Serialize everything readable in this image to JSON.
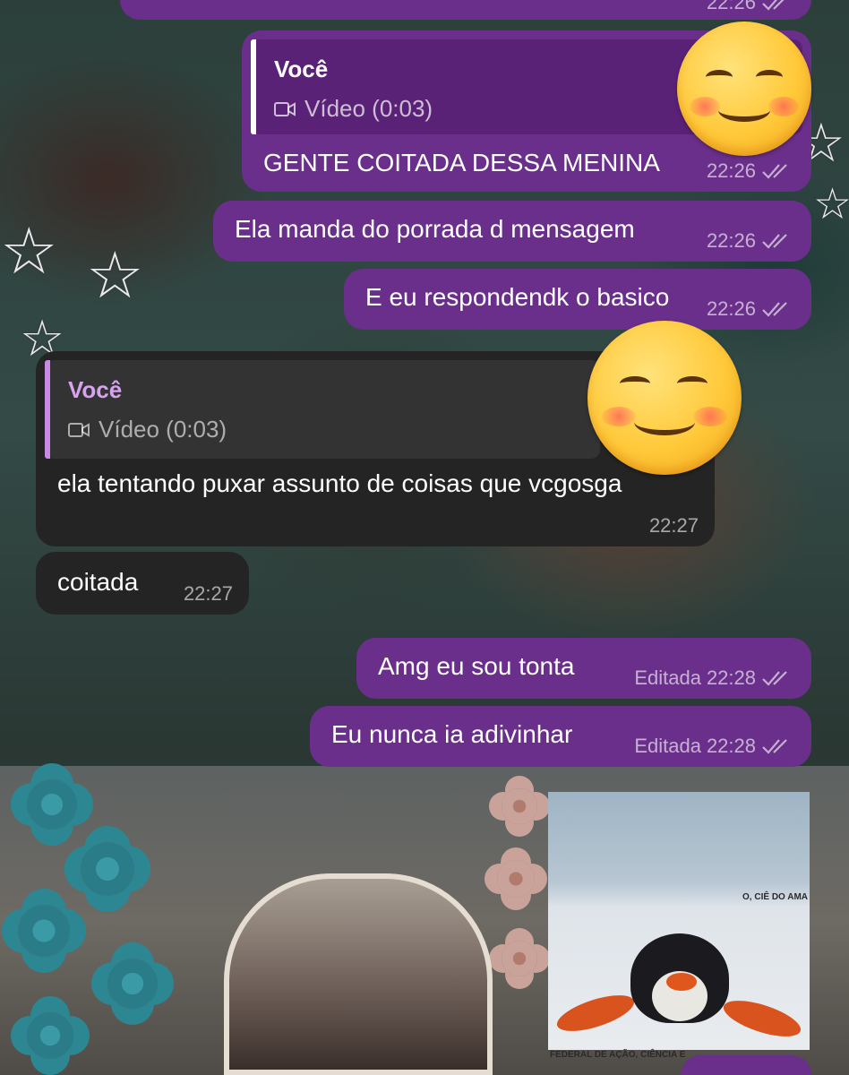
{
  "colors": {
    "outgoing_bubble": "#6a2f8a",
    "incoming_bubble": "#242424",
    "reply_block_out": "#5a2277",
    "reply_block_in": "#333333",
    "reply_accent_out": "#ffffff",
    "reply_accent_in": "#c88ae6"
  },
  "messages": [
    {
      "id": "m0",
      "direction": "out",
      "text": "",
      "time": "22:26",
      "ticks": "double"
    },
    {
      "id": "m1",
      "direction": "out",
      "reply": {
        "name": "Você",
        "icon": "video-icon",
        "preview": "Vídeo (0:03)"
      },
      "text": "GENTE COITADA DESSA MENINA",
      "time": "22:26",
      "ticks": "double"
    },
    {
      "id": "m2",
      "direction": "out",
      "text": "Ela manda do porrada d mensagem",
      "time": "22:26",
      "ticks": "double"
    },
    {
      "id": "m3",
      "direction": "out",
      "text": "E eu respondendk o basico",
      "time": "22:26",
      "ticks": "double"
    },
    {
      "id": "m4",
      "direction": "in",
      "reply": {
        "name": "Você",
        "icon": "video-icon",
        "preview": "Vídeo (0:03)"
      },
      "text": "ela tentando puxar assunto de coisas que vcgosga",
      "time": "22:27"
    },
    {
      "id": "m5",
      "direction": "in",
      "text": "coitada",
      "time": "22:27"
    },
    {
      "id": "m6",
      "direction": "out",
      "text": "Amg eu sou tonta",
      "edited": "Editada",
      "time": "22:28",
      "ticks": "double"
    },
    {
      "id": "m7",
      "direction": "out",
      "text": "Eu nunca ia adivinhar",
      "edited": "Editada",
      "time": "22:28",
      "ticks": "double"
    },
    {
      "id": "m8",
      "direction": "out",
      "type": "photo",
      "image": "pingu-sticker-photo",
      "sign_text": "FEDERAL DE AÇÃO, CIÊNCIA E",
      "side_text": "O, CIÊ DO AMA"
    }
  ],
  "overlays": [
    {
      "icon": "smiling-face-emoji-icon"
    },
    {
      "icon": "smiling-face-emoji-icon"
    }
  ]
}
